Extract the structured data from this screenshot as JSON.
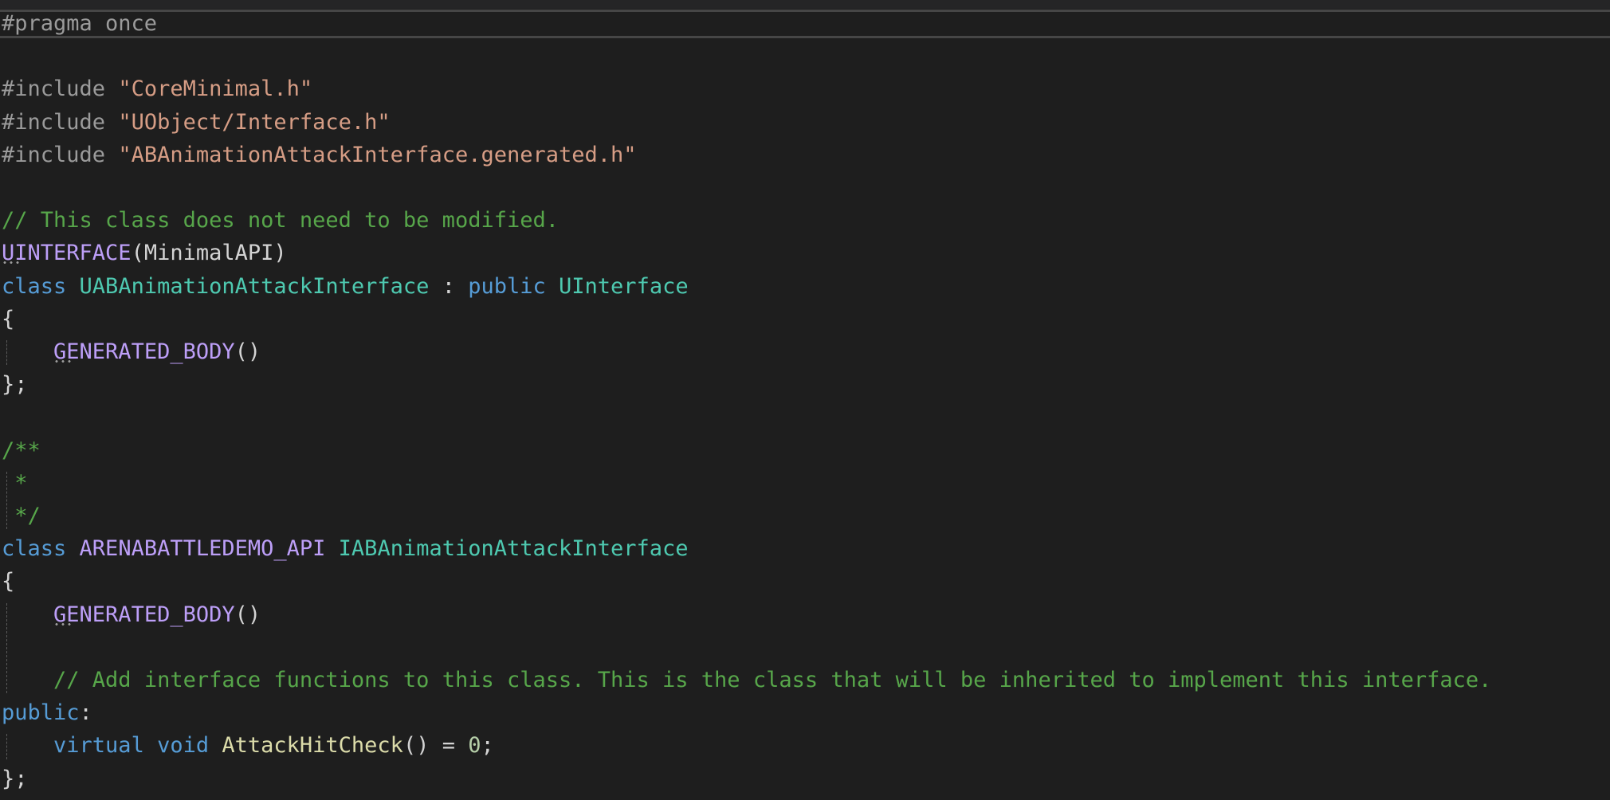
{
  "editor": {
    "lines": [
      {
        "tokens": [
          {
            "t": "#pragma once",
            "c": "pp"
          }
        ]
      },
      {
        "tokens": []
      },
      {
        "tokens": [
          {
            "t": "#include ",
            "c": "pp"
          },
          {
            "t": "\"CoreMinimal.h\"",
            "c": "str"
          }
        ]
      },
      {
        "tokens": [
          {
            "t": "#include ",
            "c": "pp"
          },
          {
            "t": "\"UObject/Interface.h\"",
            "c": "str"
          }
        ]
      },
      {
        "tokens": [
          {
            "t": "#include ",
            "c": "pp"
          },
          {
            "t": "\"ABAnimationAttackInterface.generated.h\"",
            "c": "str"
          }
        ]
      },
      {
        "tokens": []
      },
      {
        "tokens": [
          {
            "t": "// This class does not need to be modified.",
            "c": "cm"
          }
        ]
      },
      {
        "tokens": [
          {
            "t": "UINTERFACE",
            "c": "mac",
            "dots": true
          },
          {
            "t": "(MinimalAPI)",
            "c": "plain"
          }
        ]
      },
      {
        "tokens": [
          {
            "t": "class ",
            "c": "kw"
          },
          {
            "t": "UABAnimationAttackInterface",
            "c": "typ"
          },
          {
            "t": " : ",
            "c": "plain"
          },
          {
            "t": "public ",
            "c": "kw"
          },
          {
            "t": "UInterface",
            "c": "typ"
          }
        ]
      },
      {
        "tokens": [
          {
            "t": "{",
            "c": "plain"
          }
        ]
      },
      {
        "tokens": [
          {
            "t": "    ",
            "c": "plain"
          },
          {
            "t": "GENERATED_BODY",
            "c": "mac",
            "dots": true
          },
          {
            "t": "()",
            "c": "plain"
          }
        ]
      },
      {
        "tokens": [
          {
            "t": "};",
            "c": "plain"
          }
        ]
      },
      {
        "tokens": []
      },
      {
        "tokens": [
          {
            "t": "/**",
            "c": "cm"
          }
        ]
      },
      {
        "tokens": [
          {
            "t": " *",
            "c": "cm"
          }
        ]
      },
      {
        "tokens": [
          {
            "t": " */",
            "c": "cm"
          }
        ]
      },
      {
        "tokens": [
          {
            "t": "class ",
            "c": "kw"
          },
          {
            "t": "ARENABATTLEDEMO_API",
            "c": "mac"
          },
          {
            "t": " ",
            "c": "plain"
          },
          {
            "t": "IABAnimationAttackInterface",
            "c": "typ"
          }
        ]
      },
      {
        "tokens": [
          {
            "t": "{",
            "c": "plain"
          }
        ]
      },
      {
        "tokens": [
          {
            "t": "    ",
            "c": "plain"
          },
          {
            "t": "GENERATED_BODY",
            "c": "mac",
            "dots": true
          },
          {
            "t": "()",
            "c": "plain"
          }
        ]
      },
      {
        "tokens": []
      },
      {
        "tokens": [
          {
            "t": "    ",
            "c": "plain"
          },
          {
            "t": "// Add interface functions to this class. This is the class that will be inherited to implement this interface.",
            "c": "cm"
          }
        ]
      },
      {
        "tokens": [
          {
            "t": "public",
            "c": "kw"
          },
          {
            "t": ":",
            "c": "plain"
          }
        ]
      },
      {
        "tokens": [
          {
            "t": "    ",
            "c": "plain"
          },
          {
            "t": "virtual ",
            "c": "kw"
          },
          {
            "t": "void ",
            "c": "kw"
          },
          {
            "t": "AttackHitCheck",
            "c": "fn"
          },
          {
            "t": "() = ",
            "c": "plain"
          },
          {
            "t": "0",
            "c": "num"
          },
          {
            "t": ";",
            "c": "plain"
          }
        ]
      },
      {
        "tokens": [
          {
            "t": "};",
            "c": "plain"
          }
        ]
      }
    ]
  }
}
